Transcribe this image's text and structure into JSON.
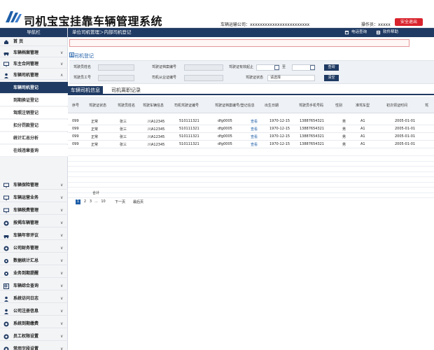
{
  "header": {
    "title": "司机宝宝挂靠车辆管理系统",
    "company": "车辆运输公司：xxxxxxxxxxxxxxxxxxxxxxxx",
    "operator": "操作员：xxxxx",
    "logout": "安全退出",
    "ck_bits": [
      "ck",
      "ck",
      "ck"
    ]
  },
  "sidebar": {
    "title": "导航栏",
    "items_top": [
      {
        "label": "首 页",
        "icon": "home-icon",
        "chev": ""
      },
      {
        "label": "车辆档案管理",
        "icon": "car-icon",
        "chev": "∨"
      },
      {
        "label": "车主合同管理",
        "icon": "monitor-icon",
        "chev": "∨"
      },
      {
        "label": "车辆司机管理",
        "icon": "person-icon",
        "chev": "∧"
      }
    ],
    "subitems": [
      "车辆司机登记",
      "到期换证登记",
      "驾照注销登记",
      "扣分罚款登记",
      "统计汇总分析",
      "在线违章查询"
    ],
    "items_bottom": [
      {
        "label": "车辆保险管理",
        "icon": "monitor-icon",
        "chev": "∨"
      },
      {
        "label": "车辆运营业务",
        "icon": "monitor-icon",
        "chev": "∨"
      },
      {
        "label": "车辆税费管理",
        "icon": "monitor-icon",
        "chev": "∨"
      },
      {
        "label": "按揭车辆管理",
        "icon": "circle-icon",
        "chev": "∨"
      },
      {
        "label": "车辆年审评议",
        "icon": "car-icon",
        "chev": "∨"
      },
      {
        "label": "公司财务管理",
        "icon": "circle-icon",
        "chev": "∨"
      },
      {
        "label": "数据统计汇总",
        "icon": "gear-icon",
        "chev": "∨"
      },
      {
        "label": "业务到期提醒",
        "icon": "gear-icon",
        "chev": "∨"
      },
      {
        "label": "车辆综合查询",
        "icon": "search-icon",
        "chev": "∨"
      },
      {
        "label": "系统访问日志",
        "icon": "person-icon",
        "chev": "∨"
      },
      {
        "label": "公司注册信息",
        "icon": "person-icon",
        "chev": "∨"
      },
      {
        "label": "系统到期缴费",
        "icon": "circle-icon",
        "chev": "∨"
      },
      {
        "label": "员工权限设置",
        "icon": "circle-icon",
        "chev": "∨"
      },
      {
        "label": "常用字段设置",
        "icon": "circle-icon",
        "chev": "∨"
      }
    ]
  },
  "topbar": {
    "breadcrumb": "单位司机管理＞内部司机登记",
    "phone_query": "电话查询",
    "help": "软件帮助"
  },
  "notice": "",
  "section": {
    "title": "司机登记"
  },
  "filter": {
    "driver_name_label": "驾驶员姓名",
    "driver_no_label": "驾驶员工号",
    "license_no_label": "驾驶证档案编号",
    "job_cert_label": "司机从业证编号",
    "valid_label": "驾驶证有效起止",
    "status_label": "驾驶证状态",
    "status_value": "请选择",
    "date_separator": "至",
    "query_btn": "查询",
    "clear_btn": "清空"
  },
  "tabs": {
    "active": "车辆司机信息",
    "inactive": "司机离职记录"
  },
  "table": {
    "headers": [
      "序号",
      "驾驶证状态",
      "驾驶员姓名",
      "驾驶车辆信息",
      "司机驾驶证编号",
      "驾驶证档案编号/登记信息",
      "出生日期",
      "驾驶员手机号码",
      "性别",
      "准驾车型",
      "初次领证时间",
      "驾"
    ],
    "rows": [
      [
        "099",
        "正常",
        "张三",
        "川A12345",
        "510111321",
        "dfg0005",
        "查看",
        "1970-12-15",
        "13887654321",
        "男",
        "A1",
        "2005-01-01"
      ],
      [
        "099",
        "正常",
        "张三",
        "川A12345",
        "510111321",
        "dfg0005",
        "查看",
        "1970-12-15",
        "13887654321",
        "男",
        "A1",
        "2005-01-01"
      ],
      [
        "099",
        "正常",
        "张三",
        "川A12345",
        "510111321",
        "dfg0005",
        "查看",
        "1970-12-15",
        "13887654321",
        "男",
        "A1",
        "2005-01-01"
      ],
      [
        "099",
        "正常",
        "张三",
        "川A12345",
        "510111321",
        "dfg0005",
        "查看",
        "1970-12-15",
        "13887654321",
        "男",
        "A1",
        "2005-01-01"
      ]
    ],
    "total_label": "合计"
  },
  "pager": {
    "pages": [
      "1",
      "2",
      "3",
      "...",
      "10"
    ],
    "next": "下一页",
    "last": "最后页"
  },
  "colors": {
    "navy": "#1f3a63",
    "accent_blue": "#1f5ea8",
    "logout_red": "#d9232d",
    "notice_red": "#c8102e"
  }
}
